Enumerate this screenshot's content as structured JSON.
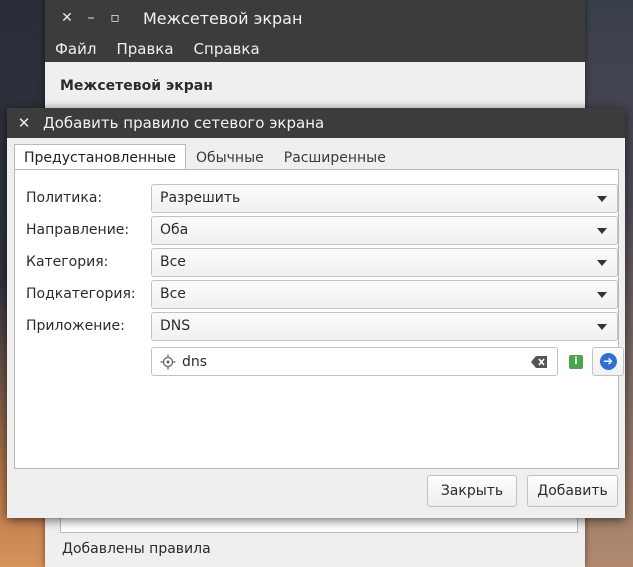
{
  "background_window": {
    "title": "Межсетевой экран",
    "menu": [
      "Файл",
      "Правка",
      "Справка"
    ],
    "heading": "Межсетевой экран",
    "status": "Добавлены правила"
  },
  "dialog": {
    "title": "Добавить правило сетевого экрана",
    "tabs": [
      {
        "label": "Предустановленные",
        "active": true
      },
      {
        "label": "Обычные",
        "active": false
      },
      {
        "label": "Расширенные",
        "active": false
      }
    ],
    "fields": [
      {
        "label": "Политика:",
        "value": "Разрешить"
      },
      {
        "label": "Направление:",
        "value": "Оба"
      },
      {
        "label": "Категория:",
        "value": "Все"
      },
      {
        "label": "Подкатегория:",
        "value": "Все"
      },
      {
        "label": "Приложение:",
        "value": "DNS"
      }
    ],
    "search": {
      "value": "dns"
    },
    "buttons": {
      "close": "Закрыть",
      "add": "Добавить"
    }
  },
  "colors": {
    "titlebar": "#3c3c3c",
    "window_bg": "#efefef",
    "panel_bg": "#ffffff",
    "info_icon": "#4aa54a",
    "go_icon": "#2f6fd0"
  }
}
